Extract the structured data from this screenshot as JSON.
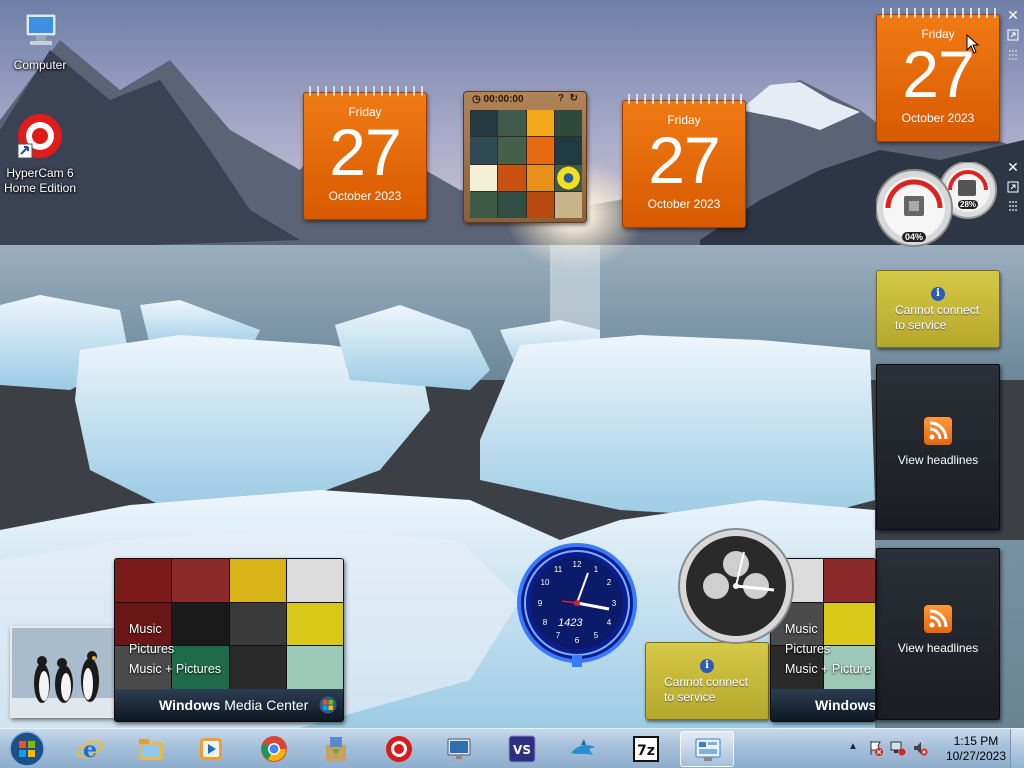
{
  "desktop": {
    "icons": [
      {
        "label": "Computer",
        "icon": "computer-icon"
      },
      {
        "label": "HyperCam 6 Home Edition",
        "icon": "hypercam-icon"
      }
    ]
  },
  "gadgets": {
    "calendar_1": {
      "weekday": "Friday",
      "day": "27",
      "month_year": "October 2023"
    },
    "calendar_2": {
      "weekday": "Friday",
      "day": "27",
      "month_year": "October 2023"
    },
    "calendar_3": {
      "weekday": "Friday",
      "day": "27",
      "month_year": "October 2023"
    },
    "puzzle": {
      "timer": "00:00:00"
    },
    "cpu_meter": {
      "cpu_percent": "04%",
      "memory_percent": "28%",
      "cpu": 0.04,
      "memory": 0.28
    },
    "weather_1": {
      "message_line1": "Cannot connect",
      "message_line2": "to service"
    },
    "weather_2": {
      "message_line1": "Cannot connect",
      "message_line2": "to service"
    },
    "feed_1": {
      "label": "View headlines"
    },
    "feed_2": {
      "label": "View headlines"
    },
    "neon_clock": {
      "number": "1423"
    },
    "media_center_1": {
      "items": [
        "Music",
        "Pictures",
        "Music + Pictures"
      ],
      "brand_prefix": "Windows",
      "brand_suffix": "Media Center"
    },
    "media_center_2": {
      "items": [
        "Music",
        "Pictures",
        "Music + Picture"
      ],
      "brand_prefix": "Windows"
    }
  },
  "taskbar": {
    "start_icon": "windows-start-icon",
    "pinned": [
      {
        "name": "internet-explorer-icon",
        "color": "#1f6fd1"
      },
      {
        "name": "windows-explorer-icon",
        "color": "#e7b84a"
      },
      {
        "name": "media-player-icon",
        "color": "#f0a030"
      },
      {
        "name": "chrome-icon",
        "color": "#4285f4"
      },
      {
        "name": "installer-icon",
        "color": "#6aa84f"
      },
      {
        "name": "hypercam-icon",
        "color": "#d81b1b"
      },
      {
        "name": "remote-desktop-icon",
        "color": "#2f6fae"
      },
      {
        "name": "visual-studio-icon",
        "color": "#2d2f7f"
      },
      {
        "name": "app-shark-icon",
        "color": "#2a8ecf"
      },
      {
        "name": "7zip-icon",
        "color": "#111111"
      },
      {
        "name": "gadgets-icon",
        "color": "#3b80c6"
      }
    ],
    "time": "1:15 PM",
    "date": "10/27/2023"
  }
}
